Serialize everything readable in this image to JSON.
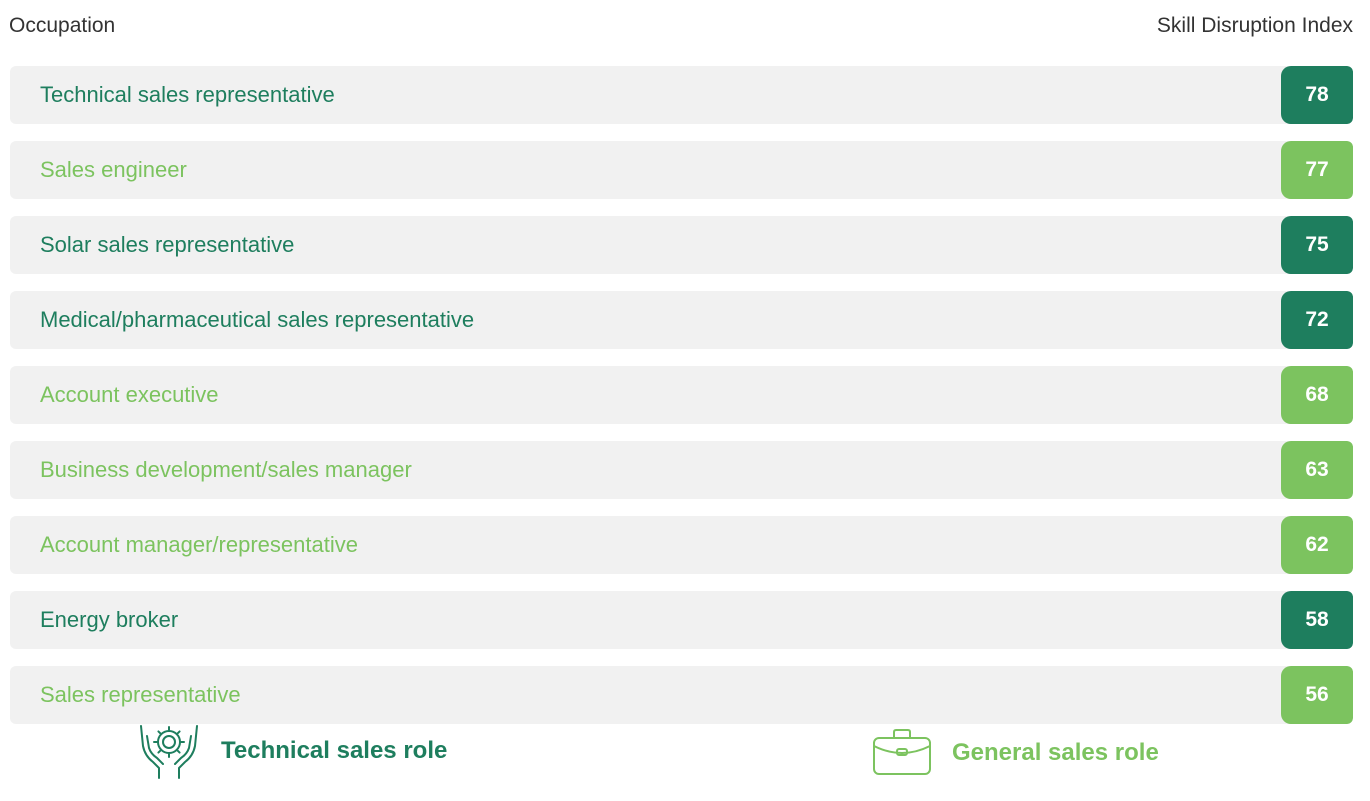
{
  "header": {
    "left": "Occupation",
    "right": "Skill Disruption Index"
  },
  "colors": {
    "technical": "#1e7e5e",
    "general": "#7cc35f",
    "row_bg": "#f1f1f1"
  },
  "chart_data": {
    "type": "bar",
    "categories": [
      "Technical sales representative",
      "Sales engineer",
      "Solar sales representative",
      "Medical/pharmaceutical sales representative",
      "Account executive",
      "Business development/sales manager",
      "Account manager/representative",
      "Energy broker",
      "Sales representative"
    ],
    "values": [
      78,
      77,
      75,
      72,
      68,
      63,
      62,
      58,
      56
    ],
    "role_type": [
      "technical",
      "general",
      "technical",
      "technical",
      "general",
      "general",
      "general",
      "technical",
      "general"
    ],
    "xlabel": "Occupation",
    "ylabel": "Skill Disruption Index"
  },
  "legend": {
    "technical": {
      "label": "Technical sales role",
      "icon": "gear-hands-icon"
    },
    "general": {
      "label": "General sales role",
      "icon": "briefcase-icon"
    }
  }
}
